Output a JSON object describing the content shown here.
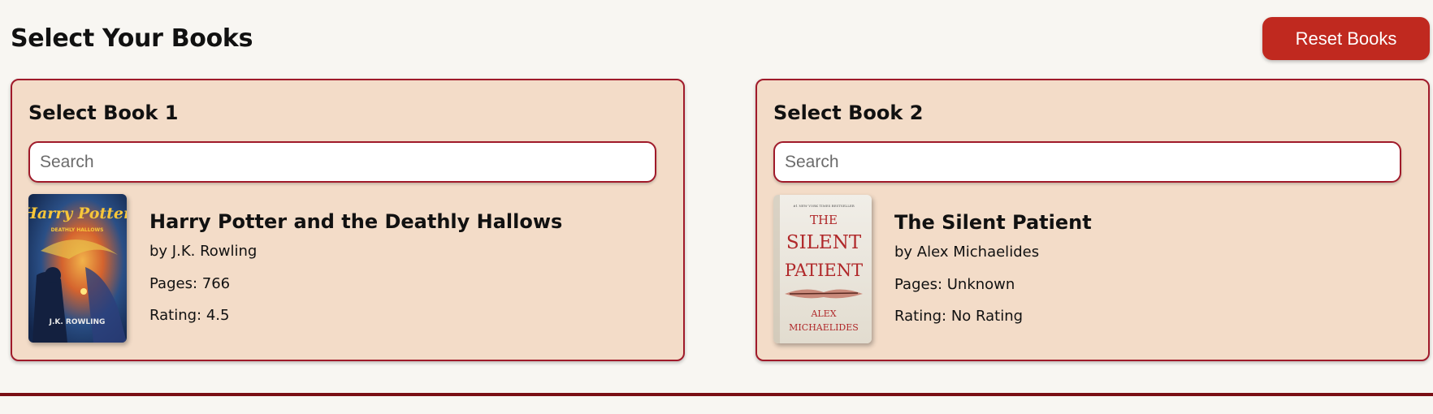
{
  "header": {
    "title": "Select Your Books",
    "reset_label": "Reset Books"
  },
  "books": [
    {
      "card_title": "Select Book 1",
      "search_placeholder": "Search",
      "cover_title_text": "Harry Potter",
      "cover_subtitle_text": "DEATHLY HALLOWS",
      "cover_author_text": "J.K. ROWLING",
      "title": "Harry Potter and the Deathly Hallows",
      "author": "by J.K. Rowling",
      "pages": "Pages: 766",
      "rating": "Rating: 4.5"
    },
    {
      "card_title": "Select Book 2",
      "search_placeholder": "Search",
      "cover_banner_text": "#1 NEW YORK TIMES BESTSELLER",
      "cover_title_line1": "THE",
      "cover_title_line2": "SILENT",
      "cover_title_line3": "PATIENT",
      "cover_author_line1": "ALEX",
      "cover_author_line2": "MICHAELIDES",
      "title": "The Silent Patient",
      "author": "by Alex Michaelides",
      "pages": "Pages: Unknown",
      "rating": "Rating: No Rating"
    }
  ],
  "colors": {
    "accent": "#c0291f",
    "card_background": "#f3dcc8",
    "card_border": "#a01a2a",
    "divider": "#7a0e14"
  }
}
